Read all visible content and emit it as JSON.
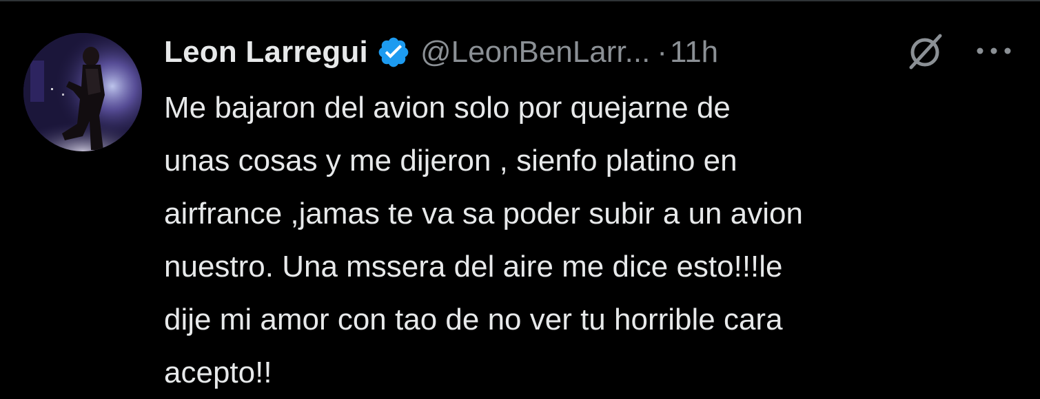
{
  "tweet": {
    "author": {
      "display_name": "Leon Larregui",
      "handle": "@LeonBenLarr...",
      "verified": true,
      "avatar_icon": "concert-performer-avatar"
    },
    "separator": "·",
    "timestamp": "11h",
    "icons": {
      "verified": "verified-badge-icon",
      "grok": "grok-icon",
      "more": "more-options-icon"
    },
    "text_lines": [
      "Me bajaron del avion solo por quejarne de",
      "unas cosas y me dijeron , sienfo platino en",
      "airfrance ,jamas te va sa poder subir a un avion",
      "nuestro. Una mssera del aire me dice esto!!!le",
      "dije mi amor con tao de no ver tu horrible cara",
      "acepto!!"
    ]
  },
  "colors": {
    "background": "#000000",
    "primary_text": "#e7e9ea",
    "secondary_text": "#8b9095",
    "verified_blue": "#1d9bf0",
    "divider": "#2f3336"
  }
}
